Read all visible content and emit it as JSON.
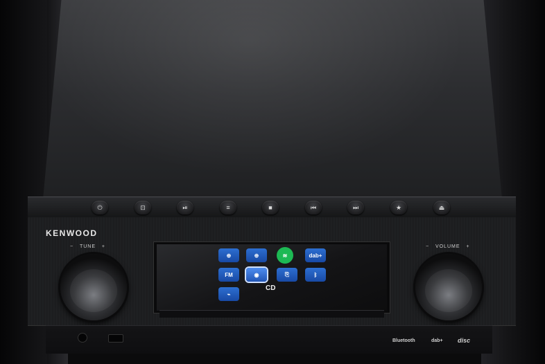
{
  "device": {
    "brand": "KENWOOD"
  },
  "top_buttons": [
    {
      "icon": "power-icon",
      "glyph": "⏻"
    },
    {
      "icon": "input-icon",
      "glyph": "⊡"
    },
    {
      "icon": "play-pause-icon",
      "glyph": "⏯"
    },
    {
      "icon": "menu-icon",
      "glyph": "≡"
    },
    {
      "icon": "stop-icon",
      "glyph": "■"
    },
    {
      "icon": "previous-icon",
      "glyph": "⏮"
    },
    {
      "icon": "next-icon",
      "glyph": "⏭"
    },
    {
      "icon": "favorite-icon",
      "glyph": "★"
    },
    {
      "icon": "eject-icon",
      "glyph": "⏏"
    }
  ],
  "tune": {
    "label": "TUNE",
    "minus": "−",
    "plus": "+"
  },
  "volume": {
    "label": "VOLUME",
    "minus": "−",
    "plus": "+"
  },
  "screen": {
    "sources": [
      {
        "name": "internet-radio-icon",
        "glyph": "⊕"
      },
      {
        "name": "internet-radio-2-icon",
        "glyph": "⊕"
      },
      {
        "name": "spotify-icon",
        "glyph": "≋"
      },
      {
        "name": "dab-icon",
        "text": "dab+"
      },
      {
        "name": "fm-icon",
        "text": "FM"
      },
      {
        "name": "cd-icon",
        "glyph": "◉"
      },
      {
        "name": "usb-icon",
        "glyph": "⎘"
      },
      {
        "name": "bluetooth-icon",
        "glyph": "ᛒ"
      },
      {
        "name": "aux-icon",
        "glyph": "⌁"
      }
    ],
    "selected_label": "CD"
  },
  "bottom": {
    "bluetooth_logo": "Bluetooth",
    "dab_logo": "dab+",
    "disc_logo": "disc"
  },
  "colors": {
    "tile_blue": "#2d6fd1",
    "spotify_green": "#1db954"
  }
}
